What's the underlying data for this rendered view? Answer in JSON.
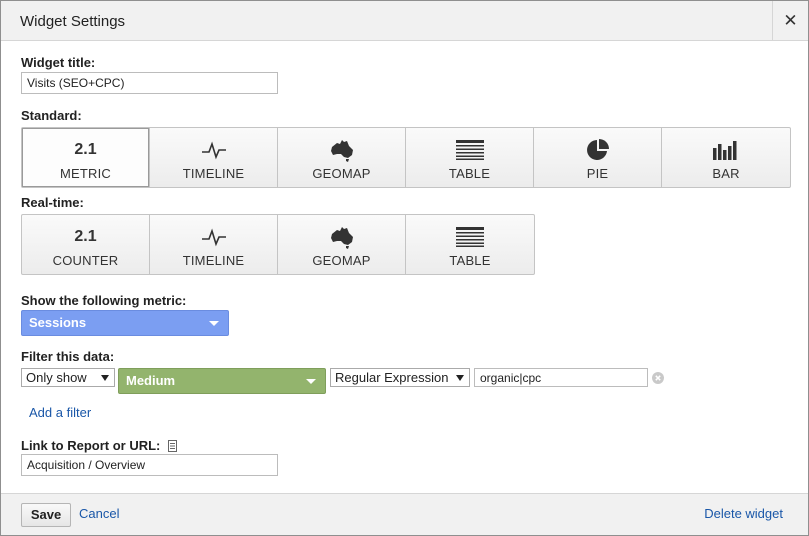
{
  "dialog": {
    "title": "Widget Settings",
    "close_glyph": "✕"
  },
  "widget_title": {
    "label": "Widget title:",
    "value": "Visits (SEO+CPC)"
  },
  "standard": {
    "label": "Standard:",
    "buttons": [
      {
        "icon": "metric-number-icon",
        "icon_text": "2.1",
        "label": "METRIC",
        "selected": true
      },
      {
        "icon": "timeline-icon",
        "label": "TIMELINE"
      },
      {
        "icon": "geomap-icon",
        "label": "GEOMAP"
      },
      {
        "icon": "table-icon",
        "label": "TABLE"
      },
      {
        "icon": "pie-icon",
        "label": "PIE"
      },
      {
        "icon": "bar-icon",
        "label": "BAR"
      }
    ]
  },
  "realtime": {
    "label": "Real-time:",
    "buttons": [
      {
        "icon": "counter-number-icon",
        "icon_text": "2.1",
        "label": "COUNTER"
      },
      {
        "icon": "timeline-icon",
        "label": "TIMELINE"
      },
      {
        "icon": "geomap-icon",
        "label": "GEOMAP"
      },
      {
        "icon": "table-icon",
        "label": "TABLE"
      }
    ]
  },
  "metric": {
    "label": "Show the following metric:",
    "selected": "Sessions",
    "color": "#7b9ef2"
  },
  "filter": {
    "label": "Filter this data:",
    "mode": "Only show",
    "dimension": "Medium",
    "dimension_color": "#93b46d",
    "match_type": "Regular Expression",
    "value": "organic|cpc",
    "add_label": "Add a filter"
  },
  "link": {
    "label": "Link to Report or URL:",
    "value": "Acquisition / Overview"
  },
  "footer": {
    "save": "Save",
    "cancel": "Cancel",
    "delete": "Delete widget"
  }
}
